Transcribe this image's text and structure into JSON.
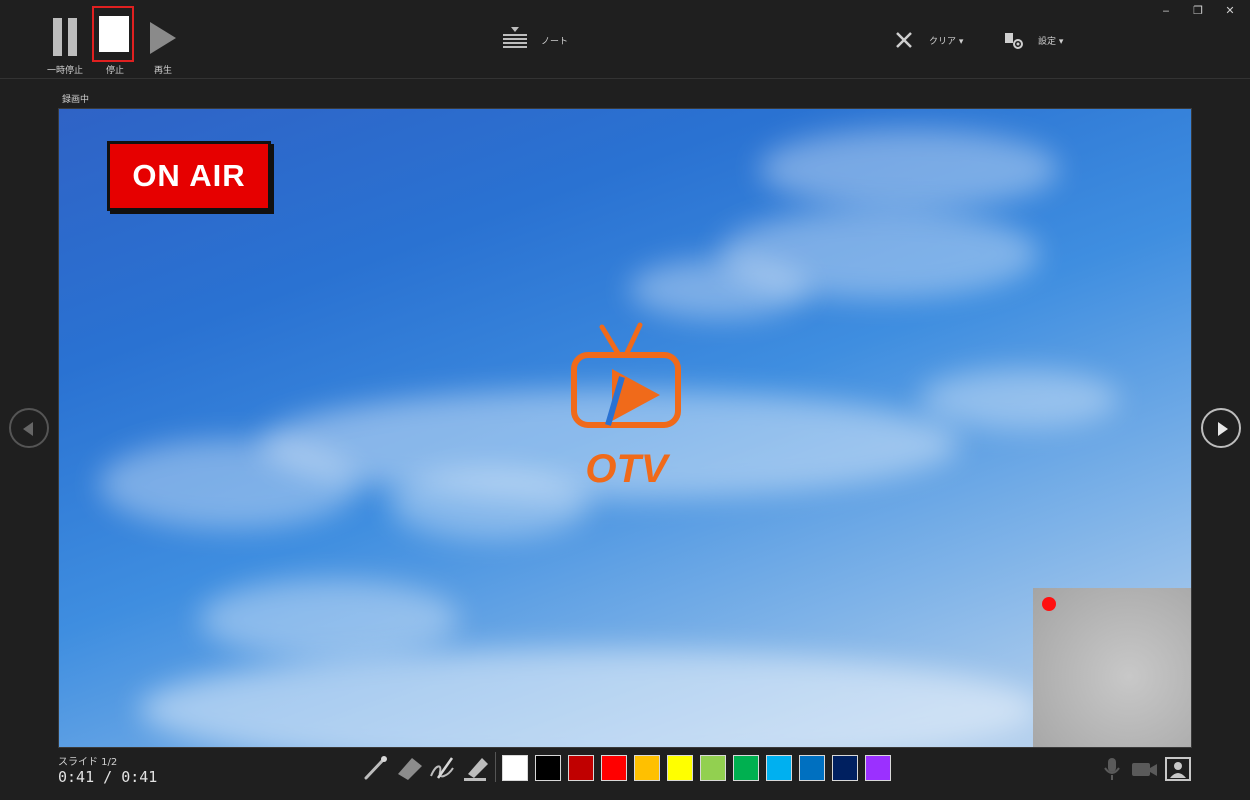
{
  "toolbar": {
    "pause_label": "一時停止",
    "stop_label": "停止",
    "play_label": "再生",
    "notes_label": "ノート",
    "clear_label": "クリア ▾",
    "settings_label": "設定 ▾",
    "minimize_glyph": "‒",
    "restore_glyph": "❐",
    "close_glyph": "✕"
  },
  "recording_label": "録画中",
  "slide": {
    "badge_text": "ON AIR",
    "logo_text": "OTV",
    "logo_color": "#f06a1a",
    "badge_color": "#e60000"
  },
  "footer": {
    "slide_counter": "スライド 1/2",
    "time": "0:41 / 0:41"
  },
  "pen_tools": [
    "pen-icon",
    "eraser-icon",
    "pen-fine-icon",
    "highlighter-icon"
  ],
  "colors": [
    "#ffffff",
    "#000000",
    "#c00000",
    "#ff0000",
    "#ffc000",
    "#ffff00",
    "#92d050",
    "#00b050",
    "#00b0f0",
    "#0070c0",
    "#002060",
    "#9b30ff"
  ],
  "status_icons": [
    "microphone-icon",
    "video-camera-icon",
    "camera-preview-icon"
  ]
}
